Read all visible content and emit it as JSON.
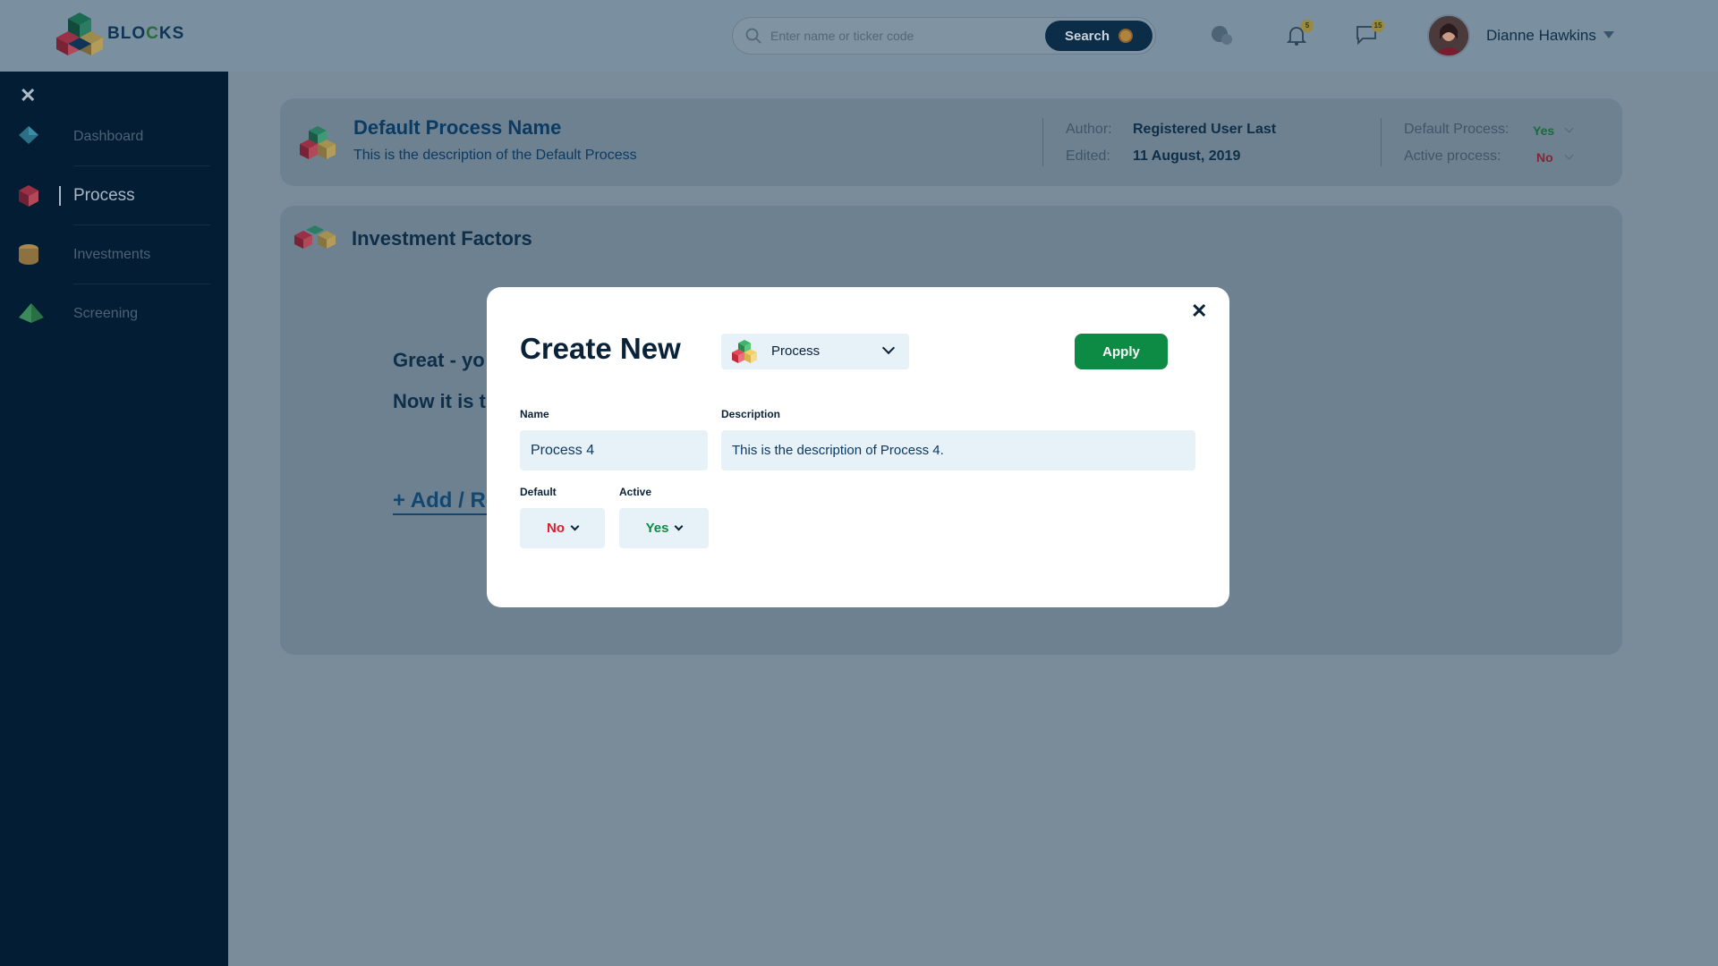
{
  "brand": {
    "name_part1": "BLO",
    "name_part2": "C",
    "name_part3": "KS"
  },
  "header": {
    "search_placeholder": "Enter name or ticker code",
    "search_label": "Search",
    "notifications_count": "5",
    "messages_count": "15",
    "user_name": "Dianne Hawkins"
  },
  "sidebar": {
    "close_glyph": "✕",
    "items": [
      {
        "label": "Dashboard",
        "icon": "dashboard-diamond-icon"
      },
      {
        "label": "Process",
        "icon": "process-cube-icon"
      },
      {
        "label": "Investments",
        "icon": "investments-coin-icon"
      },
      {
        "label": "Screening",
        "icon": "screening-pyramid-icon"
      }
    ]
  },
  "process_card": {
    "title": "Default Process Name",
    "description": "This is the description of the Default Process",
    "author_label": "Author:",
    "author_value": "Registered User Last",
    "edited_label": "Edited:",
    "edited_value": "11 August, 2019",
    "default_label": "Default Process:",
    "default_value": "Yes",
    "active_label": "Active process:",
    "active_value": "No"
  },
  "factors_card": {
    "title": "Investment Factors",
    "line1": "Great - yo",
    "line2": "Now it is t",
    "link": "+ Add / Re"
  },
  "modal": {
    "close_glyph": "✕",
    "title": "Create New",
    "type_value": "Process",
    "apply_label": "Apply",
    "name_label": "Name",
    "name_value": "Process 4",
    "description_label": "Description",
    "description_value": "This is the description of Process 4.",
    "default_label": "Default",
    "default_value": "No",
    "active_label": "Active",
    "active_value": "Yes"
  },
  "colors": {
    "sidebar_bg": "#021d34",
    "primary_navy": "#0a2238",
    "apply_green": "#0d8a43",
    "yes_green": "#0d8a43",
    "no_red": "#d6202f",
    "field_bg": "#e7f1f8"
  }
}
